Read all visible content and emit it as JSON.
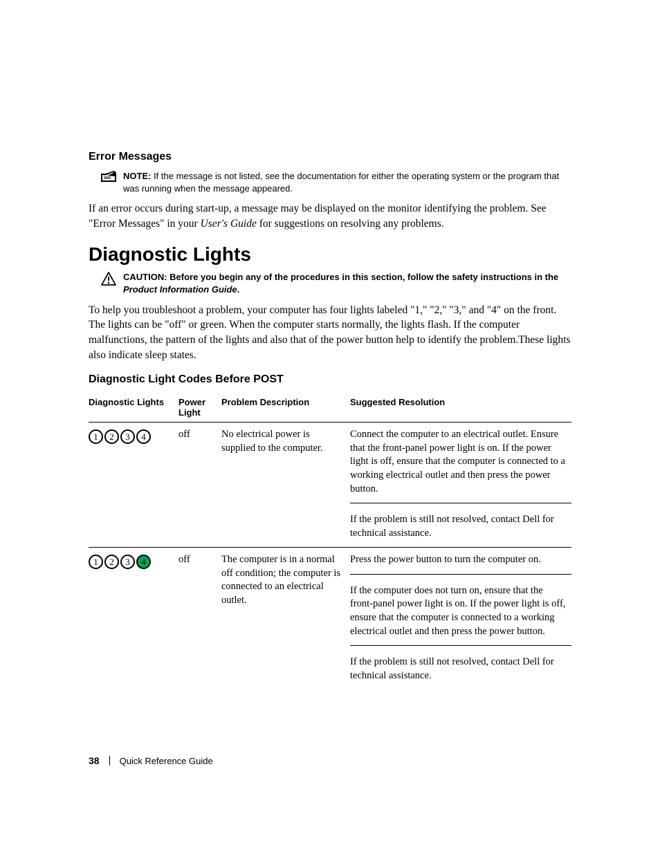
{
  "error_messages": {
    "heading": "Error Messages",
    "note_lead": "NOTE: ",
    "note_body": "If the message is not listed, see the documentation for either the operating system or the program that was running when the message appeared.",
    "para_before": "If an error occurs during start-up, a message may be displayed on the monitor identifying the problem. See \"Error Messages\" in your ",
    "para_italic": "User's Guide",
    "para_after": " for suggestions on resolving any problems."
  },
  "diagnostic_lights": {
    "heading": "Diagnostic Lights",
    "caution_lead": "CAUTION: ",
    "caution_body_before": "Before you begin any of the procedures in this section, follow the safety instructions in the ",
    "caution_body_italic": "Product Information Guide",
    "caution_body_after": ".",
    "intro": "To help you troubleshoot a problem, your computer has four lights labeled \"1,\" \"2,\" \"3,\" and \"4\" on the front. The lights can be \"off\" or green. When the computer starts normally, the lights flash. If the computer malfunctions, the pattern of the lights and also that of the power button help to identify the problem.These lights also indicate sleep states.",
    "sub_heading": "Diagnostic Light Codes Before POST",
    "table": {
      "headers": {
        "lights": "Diagnostic Lights",
        "power": "Power Light",
        "desc": "Problem Description",
        "res": "Suggested Resolution"
      },
      "rows": [
        {
          "lights": {
            "1": false,
            "2": false,
            "3": false,
            "4": false
          },
          "power": "off",
          "desc": "No electrical power is supplied to the computer.",
          "res": [
            "Connect the computer to an electrical outlet. Ensure that the front-panel power light is on. If the power light is off, ensure that the computer is connected to a working electrical outlet and then press the power button.",
            "If the problem is still not resolved, contact Dell for technical assistance."
          ]
        },
        {
          "lights": {
            "1": false,
            "2": false,
            "3": false,
            "4": true
          },
          "power": "off",
          "desc": "The computer is in a normal off condition; the computer is connected to an electrical outlet.",
          "res": [
            "Press the power button to turn the computer on.",
            "If the computer does not turn on, ensure that the front-panel power light is on. If the power light is off, ensure that the computer is connected to a working electrical outlet and then press the power button.",
            "If the problem is still not resolved, contact Dell for technical assistance."
          ]
        }
      ]
    }
  },
  "footer": {
    "page_number": "38",
    "doc_title": "Quick Reference Guide"
  },
  "light_labels": [
    "1",
    "2",
    "3",
    "4"
  ]
}
